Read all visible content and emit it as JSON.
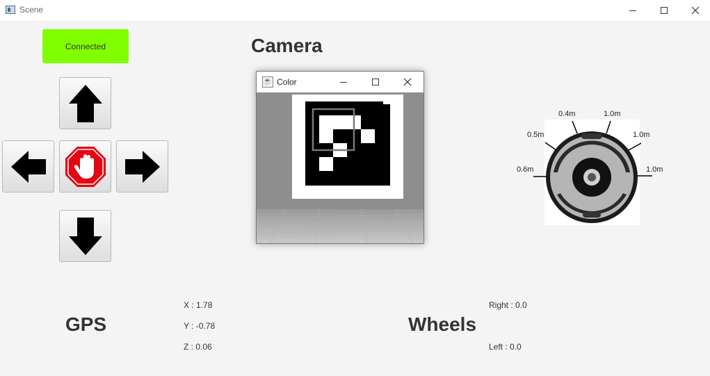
{
  "window": {
    "title": "Scene"
  },
  "controls": {
    "connection_status": "Connected",
    "connection_color": "#7fff00",
    "buttons": [
      "arrow-up",
      "arrow-left",
      "stop-hand",
      "arrow-right",
      "arrow-down"
    ]
  },
  "camera": {
    "heading": "Camera",
    "window_title": "Color",
    "window_icon": "java-icon"
  },
  "robot": {
    "sensors": [
      {
        "label": "0.6m"
      },
      {
        "label": "0.5m"
      },
      {
        "label": "0.4m"
      },
      {
        "label": "1.0m"
      },
      {
        "label": "1.0m"
      },
      {
        "label": "1.0m"
      }
    ]
  },
  "gps": {
    "heading": "GPS",
    "x": "X : 1.78",
    "y": "Y : -0.78",
    "z": "Z : 0.06"
  },
  "wheels": {
    "heading": "Wheels",
    "right": "Right : 0.0",
    "left": "Left : 0.0"
  }
}
